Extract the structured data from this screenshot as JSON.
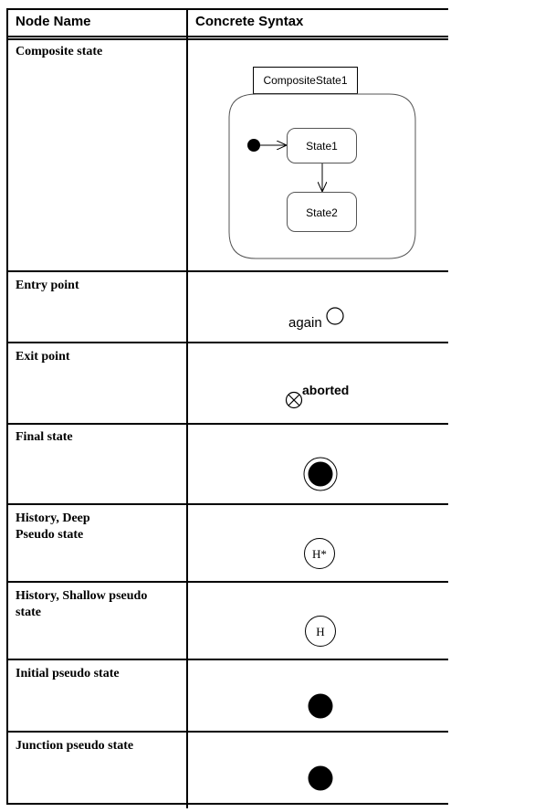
{
  "table": {
    "headers": {
      "node_name": "Node Name",
      "concrete_syntax": "Concrete Syntax"
    },
    "rows": [
      {
        "name": "Composite state",
        "notation": "composite-state-diagram",
        "diagram": {
          "composite_label": "CompositeState1",
          "state1": "State1",
          "state2": "State2"
        }
      },
      {
        "name": "Entry point",
        "notation": "entry-point-circle",
        "text": "again"
      },
      {
        "name": "Exit point",
        "notation": "exit-point-crossed-circle",
        "text": "aborted"
      },
      {
        "name": "Final state",
        "notation": "bullseye"
      },
      {
        "name_line1": "History, Deep",
        "name_line2": "Pseudo state",
        "notation": "circle-with-text",
        "text": "H*"
      },
      {
        "name_line1": "History, Shallow pseudo",
        "name_line2": "state",
        "notation": "circle-with-text",
        "text": "H"
      },
      {
        "name": "Initial pseudo state",
        "notation": "filled-circle"
      },
      {
        "name": "Junction pseudo state",
        "notation": "filled-circle"
      }
    ]
  }
}
